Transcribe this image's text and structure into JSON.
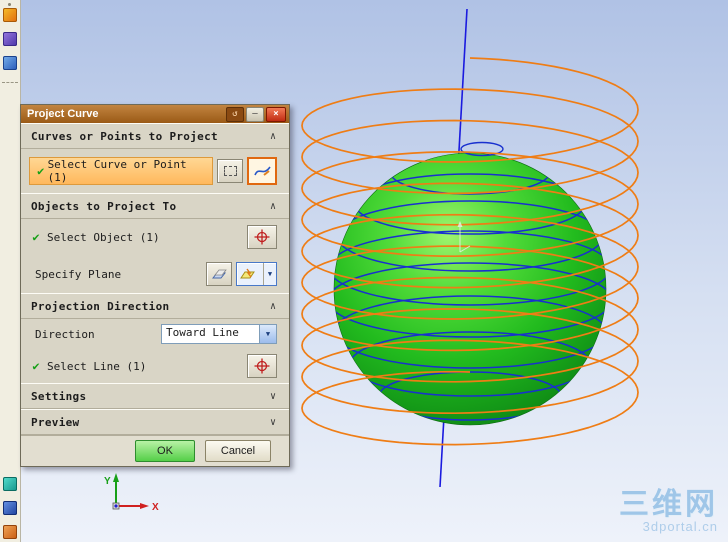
{
  "toolbar": {
    "icons": [
      "sketch-icon",
      "datum-plane-icon",
      "datum-csys-icon",
      "snap-point-icon",
      "view-orient-icon",
      "layer-icon"
    ]
  },
  "dialog": {
    "title": "Project Curve",
    "titlebar": {
      "reset_glyph": "↺",
      "minimize_glyph": "—",
      "close_glyph": "×"
    },
    "sections": [
      {
        "label": "Curves or Points to Project",
        "chevron": "∧"
      },
      {
        "label": "Objects to Project To",
        "chevron": "∧"
      },
      {
        "label": "Projection Direction",
        "chevron": "∧"
      },
      {
        "label": "Settings",
        "chevron": "∨"
      },
      {
        "label": "Preview",
        "chevron": "∨"
      }
    ],
    "rows": {
      "select_curve_label": "Select Curve or Point (1)",
      "select_object_label": "Select Object (1)",
      "specify_plane_label": "Specify Plane",
      "direction_label": "Direction",
      "direction_value": "Toward Line",
      "select_line_label": "Select Line (1)"
    },
    "check_glyph": "✔",
    "dropdown_glyph": "▼",
    "buttons": {
      "ok": "OK",
      "cancel": "Cancel"
    }
  },
  "viewport": {
    "triad": {
      "x_label": "X",
      "y_label": "Y"
    },
    "watermark": {
      "line1": "三维网",
      "line2": "3dportal.cn"
    },
    "colors": {
      "helix": "#ef7d15",
      "projected_curve": "#1830cf",
      "axis_line": "#1a1adf",
      "sphere_green": "#22bb1e",
      "background_top": "#b2c3e5",
      "background_bottom": "#eef2fa",
      "highlight_orange": "#ffc878",
      "ok_green": "#6ede60"
    }
  }
}
